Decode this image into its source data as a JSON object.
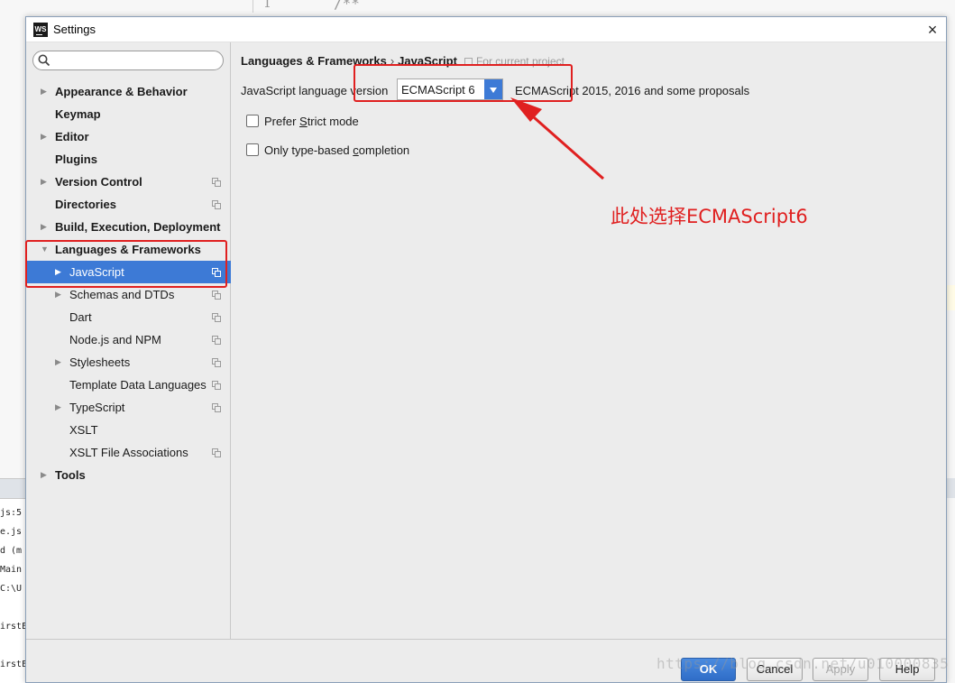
{
  "background": {
    "editor_line_number": "1",
    "editor_comment": "/**",
    "console_lines": [
      "js:5",
      "e.js",
      "d (m",
      "Main",
      "C:\\U",
      "",
      "irstE",
      "",
      "irstE"
    ]
  },
  "dialog": {
    "app_icon": "WS",
    "title": "Settings",
    "close_icon": "×"
  },
  "sidebar": {
    "search_placeholder": "",
    "items": [
      {
        "label": "Appearance & Behavior",
        "arrow": "▶",
        "bold": true,
        "project": false
      },
      {
        "label": "Keymap",
        "arrow": "",
        "bold": true,
        "project": false
      },
      {
        "label": "Editor",
        "arrow": "▶",
        "bold": true,
        "project": false
      },
      {
        "label": "Plugins",
        "arrow": "",
        "bold": true,
        "project": false
      },
      {
        "label": "Version Control",
        "arrow": "▶",
        "bold": true,
        "project": true
      },
      {
        "label": "Directories",
        "arrow": "",
        "bold": true,
        "project": true
      },
      {
        "label": "Build, Execution, Deployment",
        "arrow": "▶",
        "bold": true,
        "project": false
      },
      {
        "label": "Languages & Frameworks",
        "arrow": "▼",
        "bold": true,
        "project": false
      },
      {
        "label": "JavaScript",
        "arrow": "▶",
        "bold": false,
        "project": true,
        "selected": true
      },
      {
        "label": "Schemas and DTDs",
        "arrow": "▶",
        "bold": false,
        "project": true
      },
      {
        "label": "Dart",
        "arrow": "",
        "bold": false,
        "project": true
      },
      {
        "label": "Node.js and NPM",
        "arrow": "",
        "bold": false,
        "project": true
      },
      {
        "label": "Stylesheets",
        "arrow": "▶",
        "bold": false,
        "project": true
      },
      {
        "label": "Template Data Languages",
        "arrow": "",
        "bold": false,
        "project": true
      },
      {
        "label": "TypeScript",
        "arrow": "▶",
        "bold": false,
        "project": true
      },
      {
        "label": "XSLT",
        "arrow": "",
        "bold": false,
        "project": false
      },
      {
        "label": "XSLT File Associations",
        "arrow": "",
        "bold": false,
        "project": true
      },
      {
        "label": "Tools",
        "arrow": "▶",
        "bold": true,
        "project": false
      }
    ]
  },
  "content": {
    "breadcrumb": {
      "parent": "Languages & Frameworks",
      "separator": "›",
      "current": "JavaScript",
      "scope": "For current project"
    },
    "language_version": {
      "label": "JavaScript language version",
      "selected": "ECMAScript 6",
      "description": "ECMAScript 2015, 2016 and some proposals"
    },
    "checkboxes": [
      {
        "pre": "Prefer ",
        "mn": "S",
        "post": "trict mode",
        "checked": false
      },
      {
        "pre": "Only type-based ",
        "mn": "c",
        "post": "ompletion",
        "checked": false
      }
    ]
  },
  "footer": {
    "ok": "OK",
    "cancel": "Cancel",
    "apply": "Apply",
    "help": "Help"
  },
  "annotation": {
    "text": "此处选择ECMAScript6",
    "color": "#e02020"
  },
  "watermark": "https://blog.csdn.net/u010000835",
  "colors": {
    "selection": "#3d7ad6",
    "annotation": "#e02020"
  }
}
